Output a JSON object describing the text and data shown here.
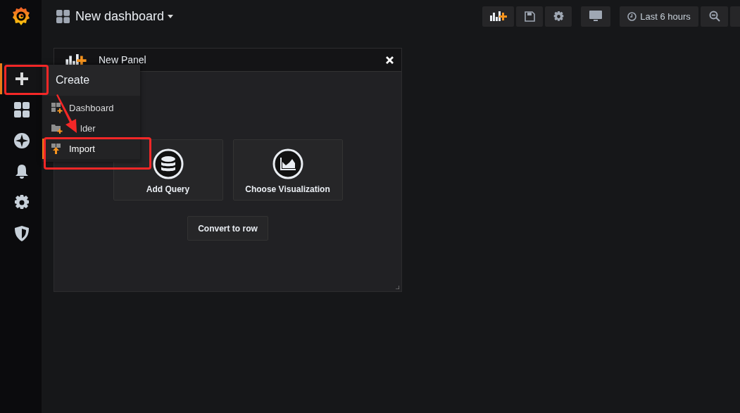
{
  "sidebar": {
    "items": [
      {
        "selected": true
      },
      {
        "selected": false
      },
      {
        "selected": false
      },
      {
        "selected": false
      },
      {
        "selected": false
      },
      {
        "selected": false
      }
    ]
  },
  "topbar": {
    "title": "New dashboard",
    "time_range": "Last 6 hours"
  },
  "panel": {
    "title": "New Panel",
    "actions": [
      "Add Query",
      "Choose Visualization"
    ],
    "convert_button": "Convert to row"
  },
  "create_menu": {
    "title": "Create",
    "items": [
      {
        "label": "Dashboard",
        "selected": false
      },
      {
        "label": "lder",
        "selected": false
      },
      {
        "label": "Import",
        "selected": true
      }
    ]
  }
}
